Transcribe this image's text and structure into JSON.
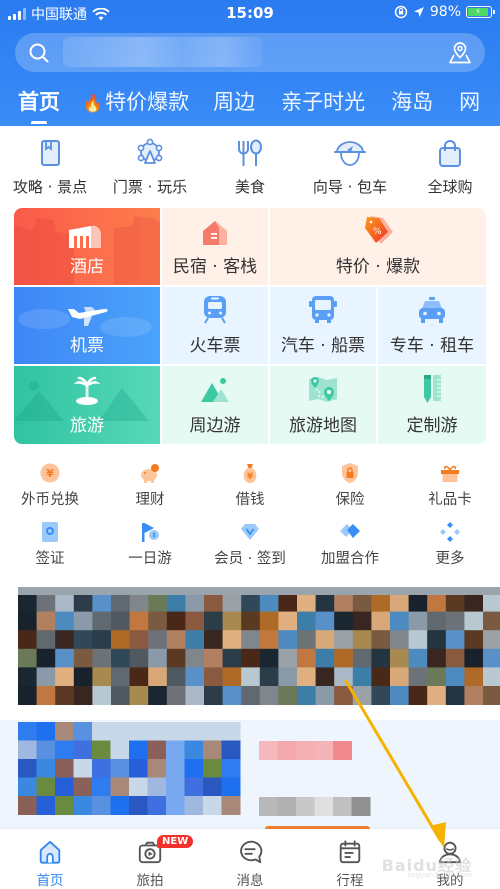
{
  "status_bar": {
    "carrier": "中国联通",
    "time": "15:09",
    "battery": "98%"
  },
  "search": {
    "placeholder": ""
  },
  "top_tabs": [
    {
      "label": "首页",
      "active": true
    },
    {
      "label": "特价爆款",
      "icon": "fire-icon"
    },
    {
      "label": "周边"
    },
    {
      "label": "亲子时光"
    },
    {
      "label": "海岛"
    },
    {
      "label": "网"
    }
  ],
  "quick_entries": [
    {
      "label": "攻略 · 景点",
      "icon": "guidebook-icon"
    },
    {
      "label": "门票 · 玩乐",
      "icon": "ferris-wheel-icon"
    },
    {
      "label": "美食",
      "icon": "fork-spoon-icon"
    },
    {
      "label": "向导 · 包车",
      "icon": "guide-hat-icon"
    },
    {
      "label": "全球购",
      "icon": "shopping-bag-icon"
    }
  ],
  "grid": {
    "hotel": {
      "label": "酒店",
      "icon": "hotel-icon",
      "color": "#fb5a4a"
    },
    "homestay": {
      "label": "民宿 · 客栈",
      "icon": "house-icon"
    },
    "deals": {
      "label": "特价 · 爆款",
      "icon": "price-tag-icon"
    },
    "flights": {
      "label": "机票",
      "icon": "airplane-icon",
      "color": "#3e86f6"
    },
    "train": {
      "label": "火车票",
      "icon": "train-icon"
    },
    "bus": {
      "label": "汽车 · 船票",
      "icon": "bus-icon"
    },
    "car": {
      "label": "专车 · 租车",
      "icon": "taxi-icon"
    },
    "travel": {
      "label": "旅游",
      "icon": "palm-tree-icon",
      "color": "#30c3a0"
    },
    "nearby": {
      "label": "周边游",
      "icon": "mountain-icon"
    },
    "map": {
      "label": "旅游地图",
      "icon": "map-pin-icon"
    },
    "custom": {
      "label": "定制游",
      "icon": "ruler-pencil-icon"
    }
  },
  "services_row1": [
    {
      "label": "外币兑换",
      "icon": "yuan-coin-icon"
    },
    {
      "label": "理财",
      "icon": "piggy-bank-icon"
    },
    {
      "label": "借钱",
      "icon": "money-bag-icon"
    },
    {
      "label": "保险",
      "icon": "shield-lock-icon"
    },
    {
      "label": "礼品卡",
      "icon": "gift-icon"
    }
  ],
  "services_row2": [
    {
      "label": "签证",
      "icon": "visa-icon"
    },
    {
      "label": "一日游",
      "icon": "flag-icon"
    },
    {
      "label": "会员 · 签到",
      "icon": "diamond-icon"
    },
    {
      "label": "加盟合作",
      "icon": "handshake-icon"
    },
    {
      "label": "更多",
      "icon": "more-dots-icon"
    }
  ],
  "bottom_nav": [
    {
      "label": "首页",
      "icon": "home-icon",
      "active": true
    },
    {
      "label": "旅拍",
      "icon": "camera-play-icon",
      "badge": "NEW"
    },
    {
      "label": "消息",
      "icon": "message-icon"
    },
    {
      "label": "行程",
      "icon": "calendar-icon"
    },
    {
      "label": "我的",
      "icon": "user-icon"
    }
  ],
  "watermark": {
    "text": "Baidu经验",
    "sub": "jingyan.baidu.com"
  },
  "colors": {
    "brand_blue": "#2a7bf0",
    "active_tab": "#2f86f3",
    "badge_red": "#f0322a",
    "annotation_arrow": "#f5b300"
  }
}
